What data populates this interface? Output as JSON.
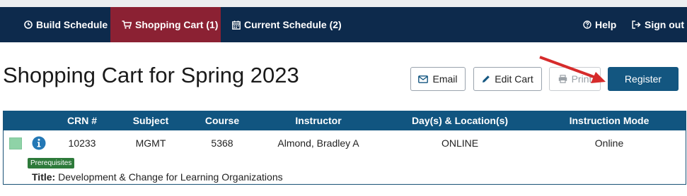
{
  "nav": {
    "items": [
      {
        "label": "Build Schedule",
        "icon": "clock-icon",
        "active": false
      },
      {
        "label": "Shopping Cart (1)",
        "icon": "cart-icon",
        "active": true
      },
      {
        "label": "Current Schedule (2)",
        "icon": "calendar-icon",
        "active": false
      }
    ],
    "help_label": "Help",
    "signout_label": "Sign out"
  },
  "page": {
    "title": "Shopping Cart for Spring 2023"
  },
  "actions": {
    "email_label": "Email",
    "edit_cart_label": "Edit Cart",
    "print_label": "Print",
    "register_label": "Register"
  },
  "table": {
    "headers": [
      "CRN #",
      "Subject",
      "Course",
      "Instructor",
      "Day(s) & Location(s)",
      "Instruction Mode"
    ],
    "rows": [
      {
        "crn": "10233",
        "subject": "MGMT",
        "course": "5368",
        "instructor": "Almond, Bradley A",
        "location": "ONLINE",
        "mode": "Online",
        "badge": "Prerequisites",
        "title_label": "Title:",
        "title": "Development & Change for Learning Organizations"
      }
    ]
  },
  "colors": {
    "navbar": "#0d2a4c",
    "active_tab": "#8b2133",
    "header": "#115580",
    "primary_button": "#135680",
    "badge": "#2d7a3a",
    "arrow": "#d62b2b"
  }
}
